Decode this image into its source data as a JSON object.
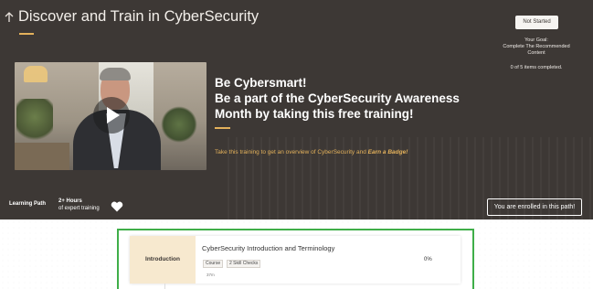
{
  "hero": {
    "title": "Discover and Train in CyberSecurity",
    "status_badge": "Not Started",
    "goal_line1": "Your Goal:",
    "goal_line2": "Complete The Recommended",
    "goal_line3": "Content",
    "progress_text": "0 of 5 items completed.",
    "headline_line1": "Be Cybersmart!",
    "headline_line2": "Be a part of the CyberSecurity Awareness",
    "headline_line3": "Month by taking this free training!",
    "description_prefix": "Take this training to get an overview of CyberSecurity and ",
    "description_emphasis": "Earn a Badge!",
    "path_label": "Learning Path",
    "hours_value": "2+ Hours",
    "hours_sub": "of expert training",
    "enrolled_label": "You are enrolled in this path!"
  },
  "module": {
    "section_label": "Introduction",
    "title": "CyberSecurity Introduction and Terminology",
    "chip_course": "Course",
    "chip_skill": "2 Skill Checks",
    "duration": "37m",
    "percent": "0%"
  },
  "colors": {
    "hero_bg": "#3d3835",
    "accent_gold": "#e3b15b",
    "highlight_green": "#3fae49",
    "section_label_bg": "#f7e9cf"
  },
  "icons": [
    "back-arrow-icon",
    "play-icon",
    "heart-icon"
  ]
}
